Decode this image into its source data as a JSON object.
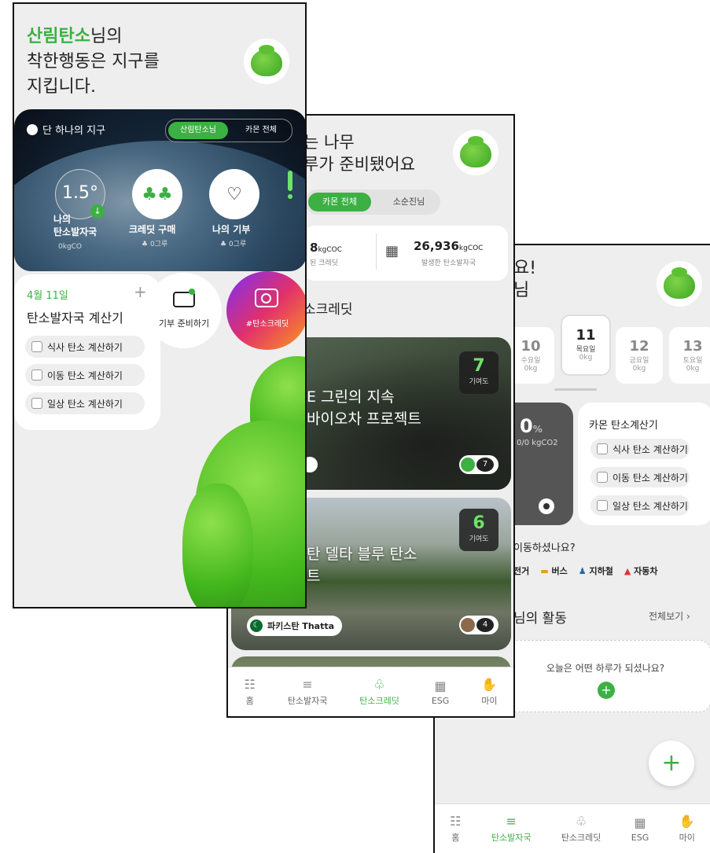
{
  "screen1": {
    "greeting_name": "산림탄소",
    "greeting_suffix": "님의",
    "greeting_line2": "착한행동은 지구를",
    "greeting_line3": "지킵니다.",
    "earth_title": "단 하나의 지구",
    "toggle_active": "산림탄소님",
    "toggle_inactive": "카몬 전체",
    "temp_value": "1.5°",
    "stat1_label": "나의\n탄소발자국",
    "stat1_value": "0kgCO",
    "stat2_label": "크레딧 구매",
    "stat2_value": "0그루",
    "stat3_label": "나의 기부",
    "stat3_value": "0그루",
    "date": "4월 11일",
    "calc_title": "탄소발자국 계산기",
    "calc_items": [
      "식사 탄소 계산하기",
      "이동 탄소 계산하기",
      "일상 탄소 계산하기"
    ],
    "donate_label": "기부 준비하기",
    "camera_label": "#탄소크레딧"
  },
  "screen2": {
    "title_line1": "는 나무",
    "title_line2": "루가 준비됐어요",
    "toggle_active": "카몬 전체",
    "toggle_inactive": "소순진님",
    "stat1_value": "8",
    "stat1_unit": "kgCOC",
    "stat1_label": "된 크레딧",
    "stat2_value": "26,936",
    "stat2_unit": "kgCOC",
    "stat2_label": "발생한 탄소발자국",
    "section_title": "소크레딧",
    "project1_title_line1": "E 그린의 지속",
    "project1_title_line2": "바이오차 프로젝트",
    "project1_badge_num": "7",
    "project1_badge_label": "기여도",
    "project1_count": "7",
    "project2_title_line1": "탄 델타 블루 탄소",
    "project2_title_line2": "트",
    "project2_badge_num": "6",
    "project2_badge_label": "기여도",
    "project2_country": "파키스탄 Thatta",
    "project2_count": "4",
    "nav": [
      "홈",
      "탄소발자국",
      "탄소크레딧",
      "ESG",
      "마이"
    ]
  },
  "screen3": {
    "title_line1": "요!",
    "title_line2": "님",
    "days": [
      {
        "num": "10",
        "name": "수요일",
        "kg": "0kg"
      },
      {
        "num": "11",
        "name": "목요일",
        "kg": "0kg"
      },
      {
        "num": "12",
        "name": "금요일",
        "kg": "0kg"
      },
      {
        "num": "13",
        "name": "토요일",
        "kg": "0kg"
      }
    ],
    "percent_value": "0",
    "percent_unit": "%",
    "percent_sub": "0/0 kgCO2",
    "calc_title": "카몬 탄소계산기",
    "calc_items": [
      "식사 탄소 계산하기",
      "이동 탄소 계산하기",
      "일상 탄소 계산하기"
    ],
    "move_question": "이동하셨나요?",
    "transport": [
      "전거",
      "버스",
      "지하철",
      "자동차"
    ],
    "activity_title": "님의 활동",
    "see_all": "전체보기",
    "today_question": "오늘은 어떤 하루가 되셨나요?",
    "nav": [
      "홈",
      "탄소발자국",
      "탄소크레딧",
      "ESG",
      "마이"
    ]
  }
}
